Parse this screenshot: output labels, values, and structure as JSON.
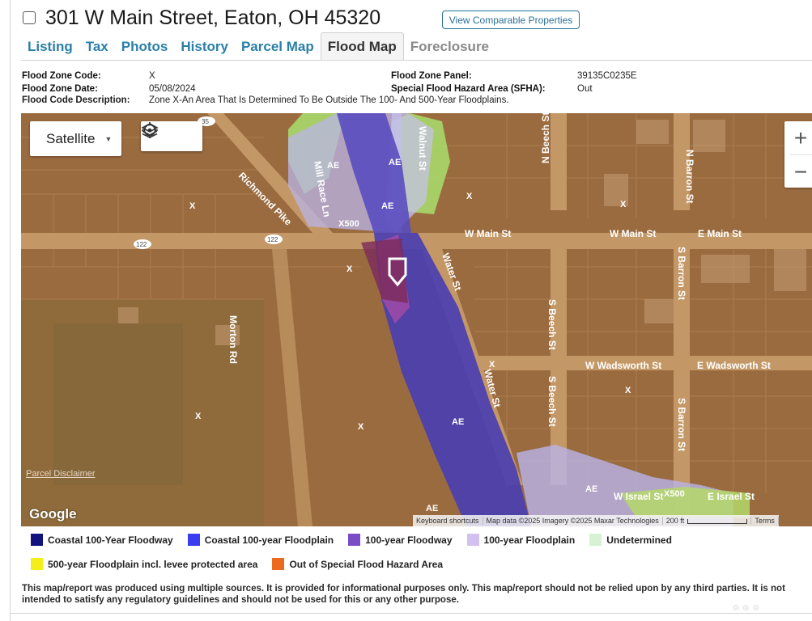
{
  "header": {
    "address": "301 W Main Street, Eaton, OH 45320",
    "comparable_button": "View Comparable Properties"
  },
  "tabs": [
    {
      "label": "Listing",
      "state": "link"
    },
    {
      "label": "Tax",
      "state": "link"
    },
    {
      "label": "Photos",
      "state": "link"
    },
    {
      "label": "History",
      "state": "link"
    },
    {
      "label": "Parcel Map",
      "state": "link"
    },
    {
      "label": "Flood Map",
      "state": "active"
    },
    {
      "label": "Foreclosure",
      "state": "disabled"
    }
  ],
  "flood_info": {
    "zone_code_label": "Flood Zone Code:",
    "zone_code": "X",
    "zone_date_label": "Flood Zone Date:",
    "zone_date": "05/08/2024",
    "description_label": "Flood Code Description:",
    "description": "Zone X-An Area That Is Determined To Be Outside The 100- And 500-Year Floodplains.",
    "panel_label": "Flood Zone Panel:",
    "panel": "39135C0235E",
    "sfha_label": "Special Flood Hazard Area (SFHA):",
    "sfha": "Out"
  },
  "map": {
    "type_selector": "Satellite",
    "layers_icon": "layers-icon",
    "locate_icon": "crosshair-icon",
    "zoom_in": "+",
    "zoom_out": "−",
    "google_logo": "Google",
    "parcel_disclaimer": "Parcel Disclaimer",
    "attribution": {
      "shortcuts": "Keyboard shortcuts",
      "data": "Map data ©2025 Imagery ©2025 Maxar Technologies",
      "scale": "200 ft",
      "terms": "Terms"
    },
    "street_labels": {
      "richmond_pike": "Richmond Pike",
      "mill_race": "Mill Race Ln",
      "walnut": "Walnut St",
      "w_main_1": "W Main St",
      "w_main_2": "W Main St",
      "e_main": "E Main St",
      "water_1": "Water St",
      "water_2": "Water St",
      "beech_n": "N Beech St",
      "beech_s1": "S Beech St",
      "beech_s2": "S Beech St",
      "barron_n": "N Barron St",
      "barron_s1": "S Barron St",
      "barron_s2": "S Barron St",
      "morton": "Morton Rd",
      "w_wadsworth": "W Wadsworth St",
      "e_wadsworth": "E Wadsworth St",
      "w_israel": "W Israel St",
      "e_israel": "E Israel St",
      "route_35": "35",
      "route_122a": "122",
      "route_122b": "122"
    },
    "zone_labels": {
      "x": "X",
      "ae": "AE",
      "x500": "X500"
    }
  },
  "legend": [
    {
      "label": "Coastal 100-Year Floodway",
      "color": "#11137e"
    },
    {
      "label": "Coastal 100-year Floodplain",
      "color": "#3b3ef0"
    },
    {
      "label": "100-year Floodway",
      "color": "#7a4cc8"
    },
    {
      "label": "100-year Floodplain",
      "color": "#d2c0f0"
    },
    {
      "label": "Undetermined",
      "color": "#d6f2d2"
    },
    {
      "label": "500-year Floodplain incl. levee protected area",
      "color": "#f4ee1a"
    },
    {
      "label": "Out of Special Flood Hazard Area",
      "color": "#ec6a1e"
    }
  ],
  "disclaimer": "This map/report was produced using multiple sources. It is provided for informational purposes only. This map/report should not be relied upon by any third parties. It is not intended to satisfy any regulatory guidelines and should not be used for this or any other purpose."
}
